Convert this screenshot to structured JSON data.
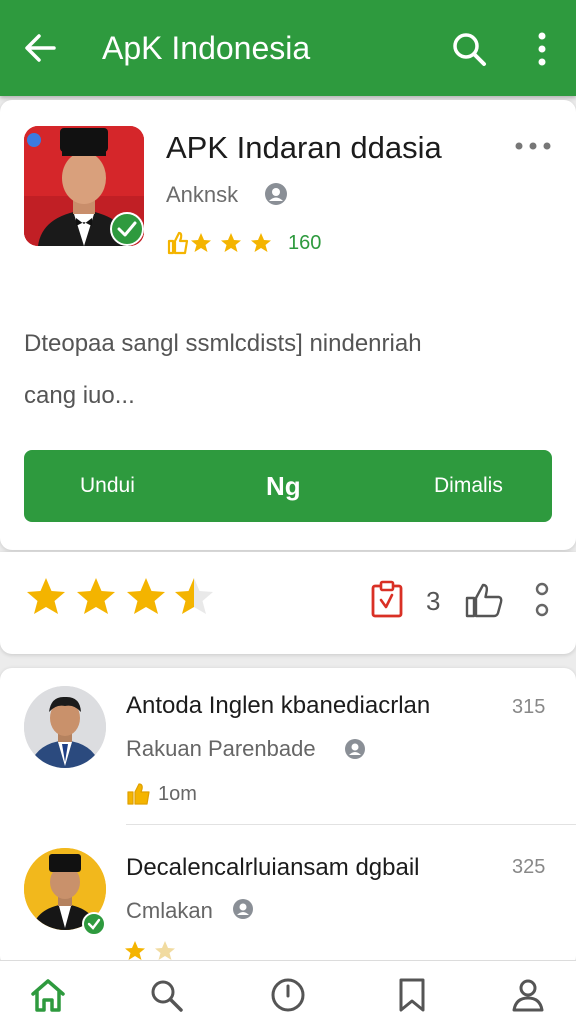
{
  "appbar": {
    "title": "ApK Indonesia",
    "icons": [
      "back-arrow-icon",
      "search-icon",
      "more-vert-icon"
    ]
  },
  "app": {
    "title": "APK Indaran ddasia",
    "developer": "Anknsk",
    "rating_count": "160",
    "description_line1": "Dteopaa sangl ssmlcdists] nindenriah",
    "description_line2": "cang iuo...",
    "buttons": {
      "left": "Undui",
      "middle": "Ng",
      "right": "Dimalis"
    }
  },
  "rating_bar": {
    "stars": 3.5,
    "stars_max": 5,
    "count": "3"
  },
  "reviews": [
    {
      "name": "Antoda Inglen kbanediacrlan",
      "sub": "Rakuan Parenbade",
      "num": "315",
      "meta": "1om"
    },
    {
      "name": "Decalencalrluiansam dgbail",
      "sub": "Cmlakan",
      "num": "325"
    }
  ],
  "colors": {
    "accent": "#2e9a3e",
    "star": "#f4b400",
    "icon_red": "#d93025"
  },
  "bottom_nav": [
    "home-icon",
    "search-icon",
    "clock-icon",
    "bookmark-icon",
    "profile-icon"
  ]
}
